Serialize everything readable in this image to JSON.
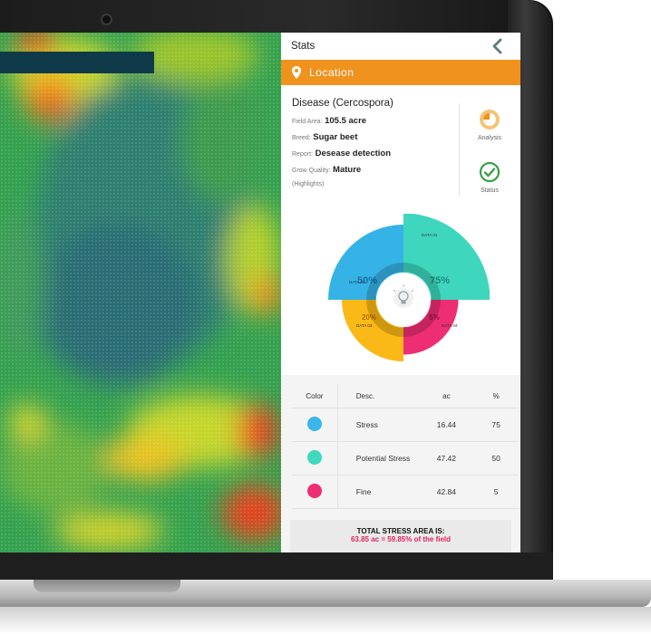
{
  "stats": {
    "title": "Stats"
  },
  "location": {
    "label": "Location"
  },
  "info": {
    "title": "Disease (Cercospora)",
    "field_area_key": "Field Area:",
    "field_area_value": "105.5 acre",
    "breed_key": "Breed:",
    "breed_value": "Sugar beet",
    "report_key": "Report:",
    "report_value": "Desease detection",
    "grow_key": "Grow Quality:",
    "grow_value": "Mature",
    "highlights": "(Highlights)"
  },
  "side": {
    "analysis_label": "Analysis",
    "status_label": "Status"
  },
  "chart_data": {
    "type": "pie",
    "segments": [
      {
        "name": "DATA 01",
        "value": 75,
        "label": "75%",
        "color": "#3ed6bd"
      },
      {
        "name": "DATA 02",
        "value": 50,
        "label": "50%",
        "color": "#35b3e6"
      },
      {
        "name": "DATA 03",
        "value": 20,
        "label": "20%",
        "color": "#fbb917"
      },
      {
        "name": "DATA 04",
        "value": 5,
        "label": "5%",
        "color": "#ee2e72"
      }
    ],
    "center_icon": "lightbulb-icon"
  },
  "table": {
    "headers": {
      "color": "Color",
      "desc": "Desc.",
      "ac": "ac",
      "pct": "%"
    },
    "rows": [
      {
        "color": "#3cb5e8",
        "desc": "Stress",
        "ac": "16.44",
        "pct": "75"
      },
      {
        "color": "#3fd9bf",
        "desc": "Potential Stress",
        "ac": "47.42",
        "pct": "50"
      },
      {
        "color": "#ee2e72",
        "desc": "Fine",
        "ac": "42.84",
        "pct": "5"
      }
    ]
  },
  "total": {
    "line1": "TOTAL STRESS AREA IS:",
    "line2": "63.85 ac = 59.85% of the field"
  },
  "colors": {
    "accent": "#f0931e",
    "navy": "#0f3a4a",
    "pink": "#e0245e"
  }
}
